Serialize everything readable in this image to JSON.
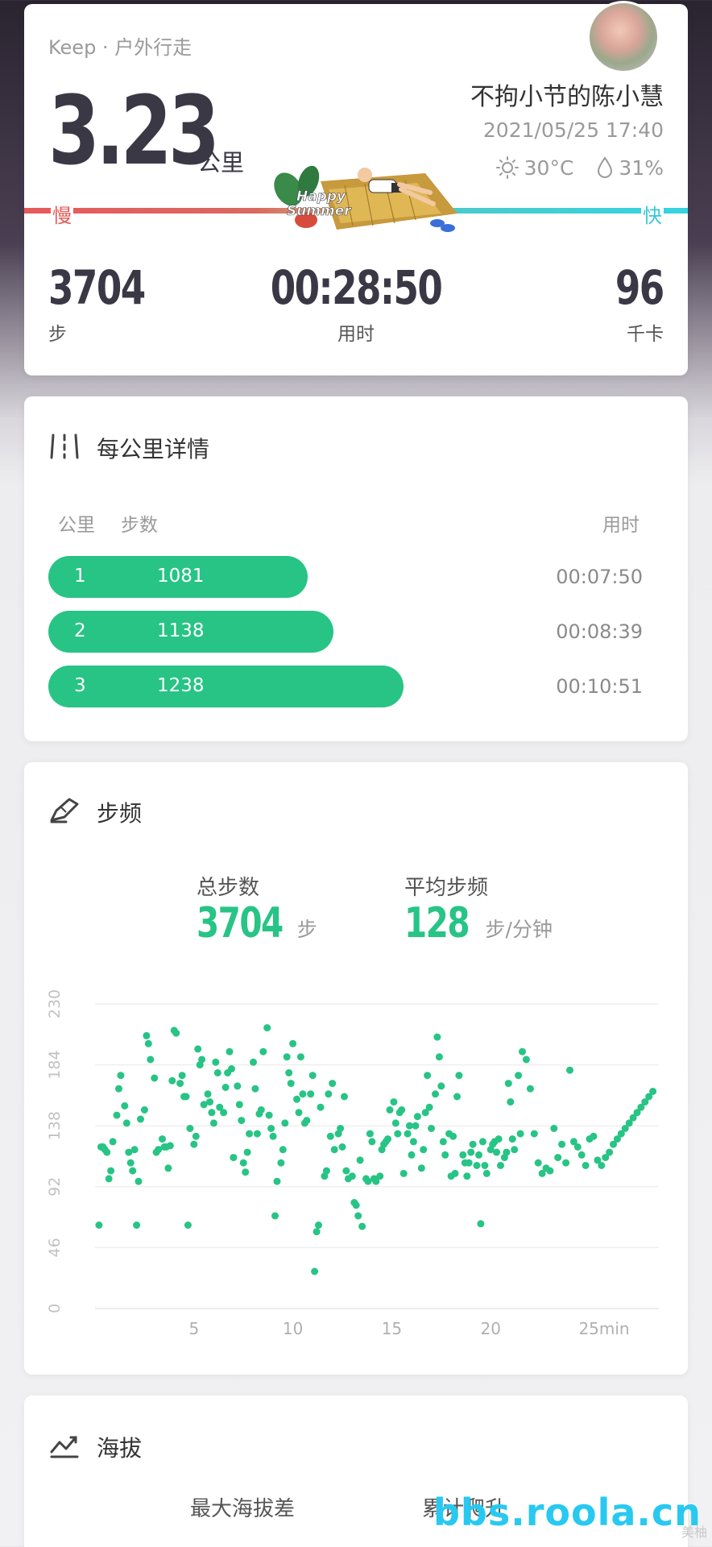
{
  "summary": {
    "source": "Keep · 户外行走",
    "distance": "3.23",
    "distance_unit": "公里",
    "user_name": "不拘小节的陈小慧",
    "datetime": "2021/05/25 17:40",
    "temperature": "30°C",
    "humidity": "31%",
    "slow_label": "慢",
    "fast_label": "快",
    "sticker_text_1": "Happy",
    "sticker_text_2": "Summer",
    "steps": {
      "value": "3704",
      "label": "步"
    },
    "duration": {
      "value": "00:28:50",
      "label": "用时"
    },
    "calories": {
      "value": "96",
      "label": "千卡"
    },
    "colors": {
      "slow": "#e65a5a",
      "fast": "#36d4e0"
    }
  },
  "per_km": {
    "title": "每公里详情",
    "headers": {
      "km": "公里",
      "steps": "步数",
      "time": "用时"
    },
    "rows": [
      {
        "km": "1",
        "steps": "1081",
        "time": "00:07:50",
        "fill": 0.59
      },
      {
        "km": "2",
        "steps": "1138",
        "time": "00:08:39",
        "fill": 0.65
      },
      {
        "km": "3",
        "steps": "1238",
        "time": "00:10:51",
        "fill": 0.81
      }
    ],
    "bar_color": "#27c485"
  },
  "cadence": {
    "title": "步频",
    "total_steps_label": "总步数",
    "total_steps_value": "3704",
    "total_steps_unit": "步",
    "avg_cadence_label": "平均步频",
    "avg_cadence_value": "128",
    "avg_cadence_unit": "步/分钟"
  },
  "chart_data": {
    "type": "scatter",
    "y_ticks": [
      "0",
      "46",
      "92",
      "138",
      "184",
      "230"
    ],
    "x_ticks": [
      "5",
      "10",
      "15",
      "20",
      "25min"
    ],
    "ylim": [
      0,
      230
    ],
    "xlim": [
      0,
      28.5
    ],
    "grid": true,
    "color": "#27c485",
    "x": [
      0.2,
      0.3,
      0.4,
      0.5,
      0.6,
      0.7,
      0.8,
      0.9,
      1.1,
      1.2,
      1.3,
      1.5,
      1.6,
      1.7,
      1.8,
      1.9,
      2.0,
      2.1,
      2.2,
      2.3,
      2.5,
      2.6,
      2.7,
      2.8,
      3.0,
      3.1,
      3.2,
      3.4,
      3.5,
      3.6,
      3.7,
      3.8,
      3.9,
      4.0,
      4.1,
      4.3,
      4.4,
      4.5,
      4.6,
      4.7,
      4.8,
      5.0,
      5.1,
      5.2,
      5.3,
      5.4,
      5.5,
      5.7,
      5.8,
      5.9,
      6.0,
      6.1,
      6.2,
      6.3,
      6.5,
      6.6,
      6.7,
      6.8,
      6.9,
      7.0,
      7.2,
      7.3,
      7.4,
      7.5,
      7.6,
      7.7,
      7.8,
      8.0,
      8.1,
      8.2,
      8.3,
      8.4,
      8.5,
      8.7,
      8.8,
      8.9,
      9.0,
      9.1,
      9.2,
      9.4,
      9.5,
      9.6,
      9.7,
      9.8,
      9.9,
      10.0,
      10.2,
      10.3,
      10.4,
      10.5,
      10.6,
      10.7,
      10.9,
      11.0,
      11.1,
      11.2,
      11.3,
      11.4,
      11.6,
      11.7,
      11.8,
      11.9,
      12.0,
      12.1,
      12.3,
      12.4,
      12.5,
      12.6,
      12.7,
      12.8,
      13.0,
      13.1,
      13.2,
      13.3,
      13.4,
      13.5,
      13.7,
      13.8,
      13.9,
      14.0,
      14.1,
      14.2,
      14.4,
      14.5,
      14.6,
      14.7,
      14.8,
      14.9,
      15.1,
      15.2,
      15.3,
      15.4,
      15.5,
      15.6,
      15.8,
      15.9,
      16.0,
      16.1,
      16.2,
      16.3,
      16.5,
      16.6,
      16.7,
      16.8,
      16.9,
      17.0,
      17.2,
      17.3,
      17.4,
      17.5,
      17.6,
      17.7,
      17.9,
      18.0,
      18.1,
      18.2,
      18.3,
      18.4,
      18.6,
      18.7,
      18.8,
      18.9,
      19.0,
      19.1,
      19.3,
      19.4,
      19.5,
      19.6,
      19.7,
      19.8,
      20.0,
      20.1,
      20.2,
      20.3,
      20.4,
      20.5,
      20.7,
      20.8,
      20.9,
      21.0,
      21.1,
      21.2,
      21.4,
      21.5,
      21.6,
      21.8,
      22.0,
      22.2,
      22.4,
      22.6,
      22.8,
      23.0,
      23.2,
      23.4,
      23.6,
      23.8,
      24.0,
      24.2,
      24.4,
      24.6,
      24.8,
      25.0,
      25.2,
      25.4,
      25.6,
      25.8,
      26.0,
      26.2,
      26.4,
      26.6,
      26.8,
      27.0,
      27.2,
      27.4,
      27.6,
      27.8,
      28.0,
      28.2
    ],
    "y": [
      63,
      122,
      122,
      120,
      118,
      98,
      104,
      126,
      146,
      166,
      176,
      153,
      140,
      118,
      110,
      104,
      120,
      63,
      96,
      143,
      150,
      206,
      200,
      188,
      174,
      118,
      120,
      128,
      122,
      122,
      106,
      123,
      172,
      210,
      208,
      170,
      176,
      160,
      160,
      63,
      136,
      124,
      130,
      196,
      184,
      188,
      154,
      162,
      156,
      148,
      140,
      186,
      178,
      152,
      148,
      167,
      178,
      194,
      181,
      114,
      168,
      154,
      142,
      110,
      103,
      118,
      132,
      186,
      166,
      132,
      147,
      150,
      194,
      212,
      146,
      136,
      130,
      70,
      96,
      110,
      120,
      140,
      190,
      178,
      170,
      200,
      158,
      148,
      190,
      162,
      140,
      142,
      162,
      176,
      28,
      58,
      63,
      152,
      100,
      104,
      162,
      130,
      170,
      120,
      132,
      136,
      122,
      160,
      104,
      98,
      100,
      80,
      78,
      70,
      112,
      62,
      98,
      96,
      132,
      126,
      98,
      96,
      100,
      120,
      124,
      126,
      128,
      150,
      156,
      140,
      132,
      148,
      150,
      102,
      132,
      138,
      116,
      126,
      138,
      145,
      106,
      120,
      148,
      176,
      152,
      136,
      162,
      205,
      190,
      168,
      126,
      116,
      132,
      100,
      130,
      102,
      160,
      176,
      116,
      110,
      100,
      110,
      118,
      124,
      108,
      116,
      64,
      126,
      108,
      102,
      120,
      124,
      126,
      118,
      128,
      108,
      114,
      118,
      170,
      156,
      128,
      120,
      176,
      132,
      194,
      188,
      166,
      132,
      110,
      102,
      106,
      104,
      136,
      114,
      124,
      110,
      180,
      126,
      122,
      116,
      108,
      128,
      130,
      112,
      108,
      114,
      118,
      124,
      128,
      132,
      136,
      140,
      144,
      148,
      152,
      156,
      160,
      164,
      170,
      176,
      184,
      192,
      200,
      208,
      214,
      190,
      170,
      168,
      176,
      162
    ]
  },
  "altitude": {
    "title": "海拔",
    "max_diff_label": "最大海拔差",
    "cumulative_label": "累计爬升"
  },
  "watermark": {
    "text": "bbs.roola.cn",
    "small_text": "美柚"
  }
}
